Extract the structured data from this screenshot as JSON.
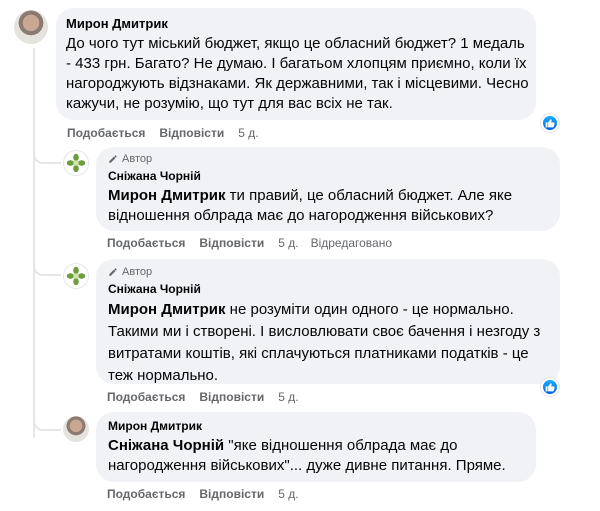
{
  "comments": [
    {
      "author": "Мирон Дмитрик",
      "lines": [
        "До чого тут міський бюджет, якщо це обласний бюджет? 1 медаль",
        "- 433 грн. Багато? Не думаю. І багатьом хлопцям приємно, коли їх",
        "нагороджують відзнаками. Як державними, так і місцевими. Чесно",
        "кажучи, не розумію, що тут для вас всіх не так."
      ],
      "actions": {
        "like": "Подобається",
        "reply": "Відповісти",
        "time": "5 д."
      }
    },
    {
      "author": "Сніжана Чорній",
      "author_tag": "Автор",
      "mention": "Мирон Дмитрик",
      "lines": [
        " ти правий, це обласний бюджет. Але яке",
        "відношення облрада має до нагородження військових?"
      ],
      "actions": {
        "like": "Подобається",
        "reply": "Відповісти",
        "time": "5 д.",
        "edited": "Відредаговано"
      }
    },
    {
      "author": "Сніжана Чорній",
      "author_tag": "Автор",
      "mention": "Мирон Дмитрик",
      "lines": [
        " не розуміти один одного - це нормально.",
        "Такими ми і створені. І висловлювати своє бачення і незгоду з",
        "витратами коштів, які сплачуються платниками податків - це",
        "теж нормально."
      ],
      "actions": {
        "like": "Подобається",
        "reply": "Відповісти",
        "time": "5 д."
      }
    },
    {
      "author": "Мирон Дмитрик",
      "mention": "Сніжана Чорній",
      "lines": [
        " \"яке відношення облрада має до",
        "нагородження військових\"... дуже дивне питання. Пряме."
      ],
      "actions": {
        "like": "Подобається",
        "reply": "Відповісти",
        "time": "5 д."
      }
    }
  ],
  "colors": {
    "bubble": "#f0f2f5",
    "secondary_text": "#65676b",
    "like_blue": "#1877f2"
  },
  "icons": [
    "like-icon",
    "pencil-icon",
    "avatar-person",
    "avatar-flower"
  ]
}
